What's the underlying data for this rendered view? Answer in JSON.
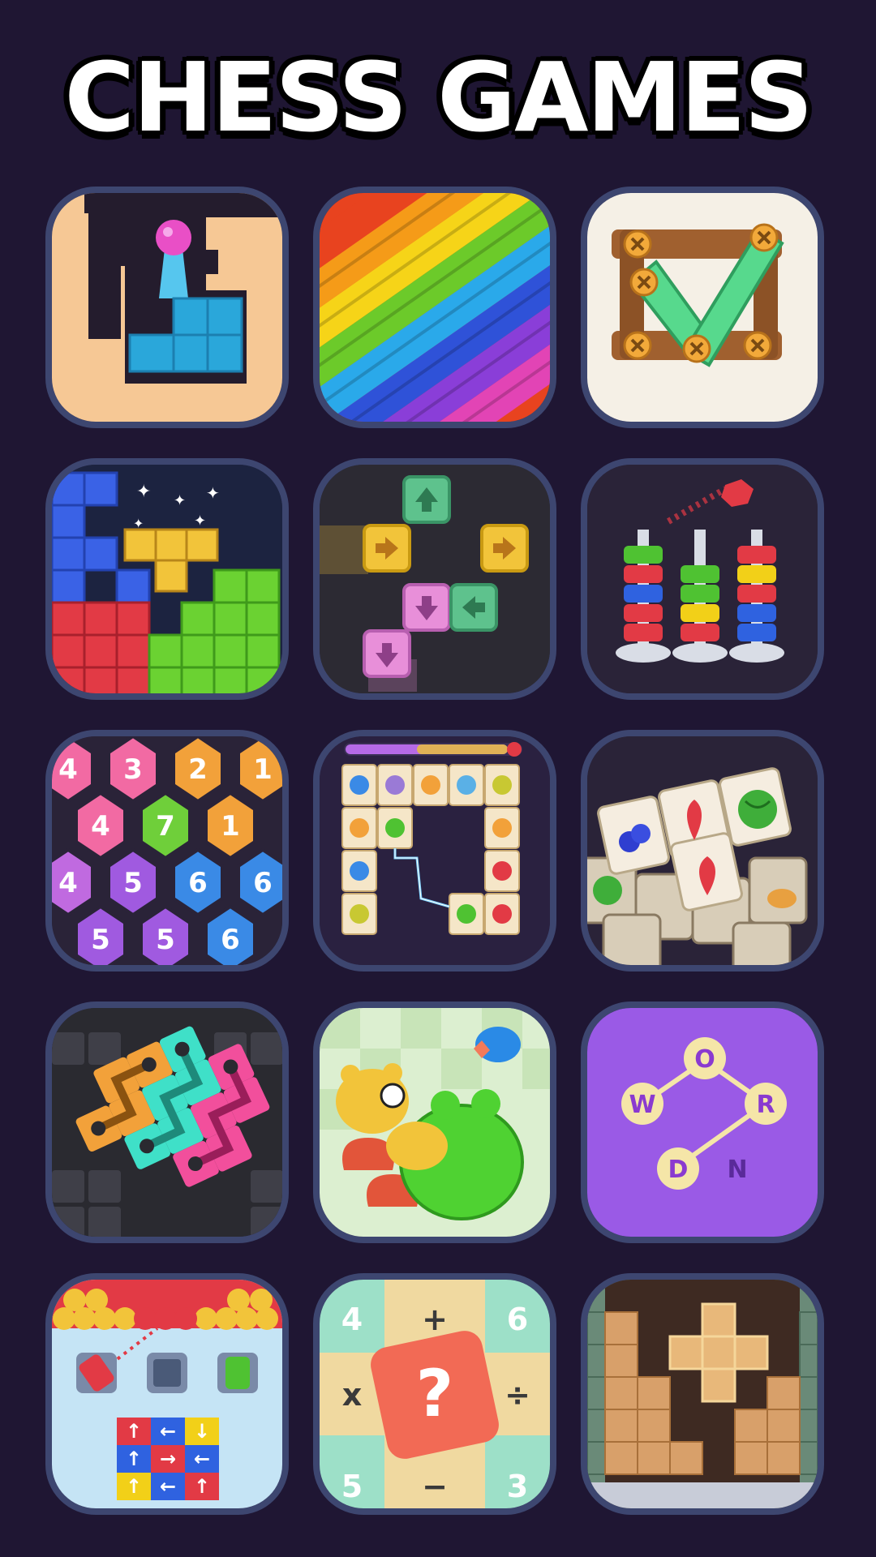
{
  "header": {
    "title": "CHESS GAMES"
  },
  "colors": {
    "background": "#1f1633",
    "tile_border": "#3d4670",
    "title_text": "#ffffff"
  },
  "games": [
    {
      "icon": "ball-drop-block-icon"
    },
    {
      "icon": "rainbow-jam-icon"
    },
    {
      "icon": "wood-screw-check-icon"
    },
    {
      "icon": "block-puzzle-icon"
    },
    {
      "icon": "arrow-blocks-icon"
    },
    {
      "icon": "nut-sort-icon"
    },
    {
      "icon": "hexa-numbers-icon",
      "numbers": [
        "4",
        "3",
        "2",
        "1",
        "4",
        "7",
        "1",
        "4",
        "5",
        "6",
        "6",
        "5",
        "5",
        "6"
      ]
    },
    {
      "icon": "onet-connect-icon"
    },
    {
      "icon": "tile-match-fruits-icon"
    },
    {
      "icon": "pipe-connect-icon"
    },
    {
      "icon": "animal-merge-icon"
    },
    {
      "icon": "word-connect-icon",
      "letters": [
        "O",
        "W",
        "R",
        "D",
        "N"
      ]
    },
    {
      "icon": "bottle-shooter-icon"
    },
    {
      "icon": "math-puzzle-icon",
      "symbols": [
        "4",
        "+",
        "6",
        "x",
        "?",
        "÷",
        "5",
        "−",
        "3"
      ]
    },
    {
      "icon": "wood-block-icon"
    }
  ]
}
